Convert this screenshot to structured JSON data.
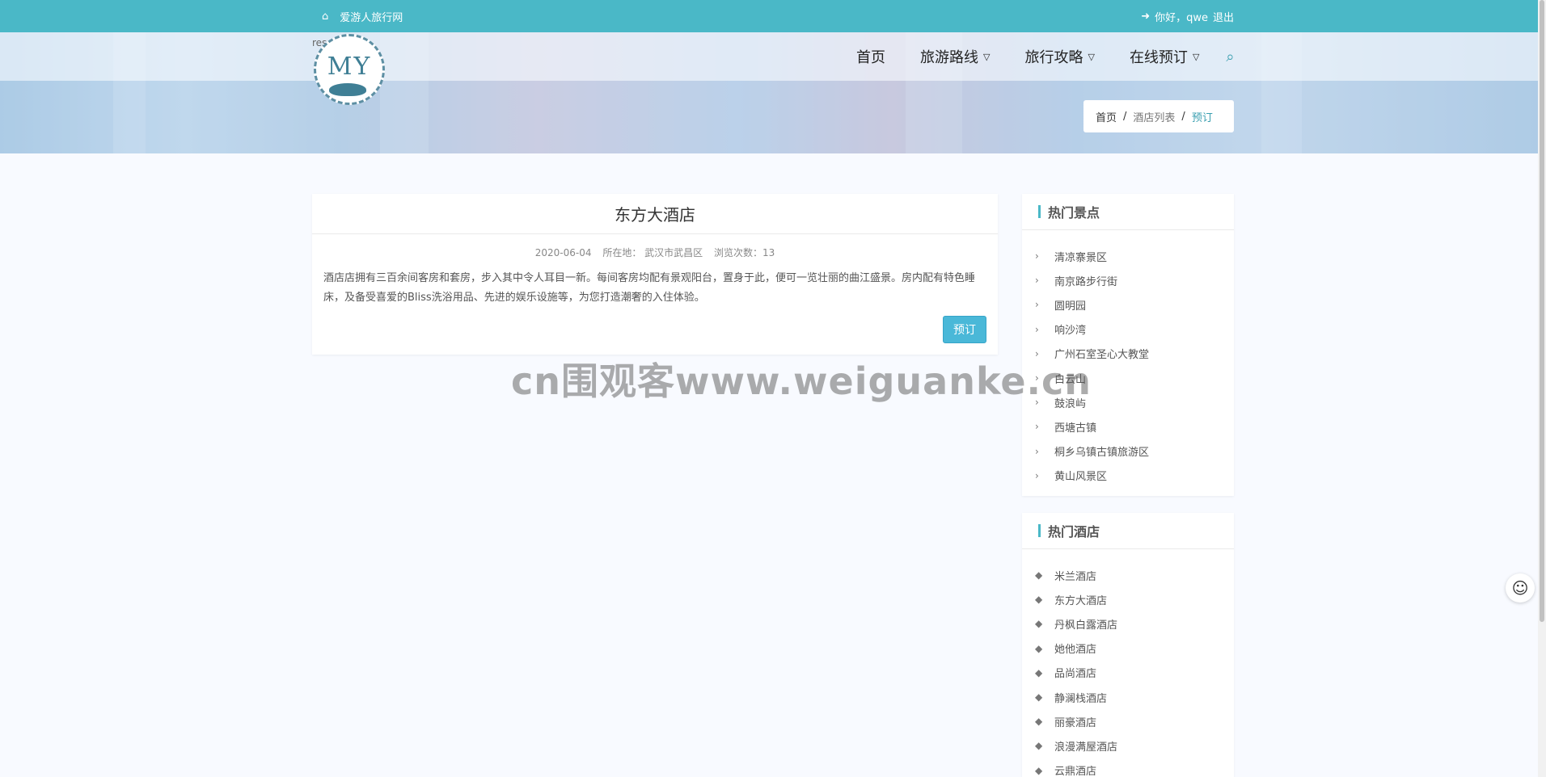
{
  "topbar": {
    "home_icon": "home-icon",
    "site_name": "爱游人旅行网",
    "login_icon": "sign-in-icon",
    "greeting": "你好，qwe",
    "logout": "退出"
  },
  "logo": {
    "alt_text": "res",
    "mark": "MY"
  },
  "nav": {
    "items": [
      "首页",
      "旅游路线",
      "旅行攻略",
      "在线预订"
    ],
    "search_icon": "search-icon"
  },
  "breadcrumb": {
    "home": "首页",
    "sep": "/",
    "list": "酒店列表",
    "current": "预订"
  },
  "hotel": {
    "title": "东方大酒店",
    "date": "2020-06-04",
    "location": "所在地：  武汉市武昌区",
    "views": "浏览次数：13",
    "description": "酒店店拥有三百余间客房和套房，步入其中令人耳目一新。每间客房均配有景观阳台，置身于此，便可一览壮丽的曲江盛景。房内配有特色睡床，及备受喜爱的Bliss洗浴用品、先进的娱乐设施等，为您打造潮奢的入住体验。",
    "book_button": "预订"
  },
  "hot_spots": {
    "title": "热门景点",
    "items": [
      "清凉寨景区",
      "南京路步行街",
      "圆明园",
      "响沙湾",
      "广州石室圣心大教堂",
      "白云山",
      "鼓浪屿",
      "西塘古镇",
      "桐乡乌镇古镇旅游区",
      "黄山风景区"
    ]
  },
  "hot_hotels": {
    "title": "热门酒店",
    "items": [
      "米兰酒店",
      "东方大酒店",
      "丹枫白露酒店",
      "她他酒店",
      "品尚酒店",
      "静澜栈酒店",
      "丽豪酒店",
      "浪漫满屋酒店",
      "云鼎酒店"
    ]
  },
  "watermark": "cn围观客www.weiguanke.cn"
}
